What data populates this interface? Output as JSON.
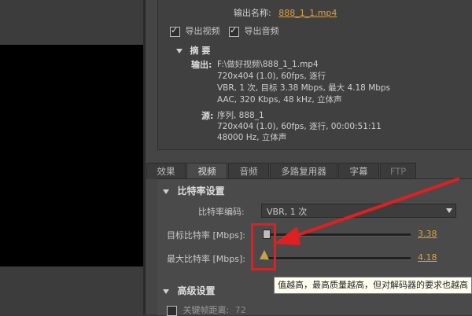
{
  "export": {
    "output_name_label": "输出名称:",
    "output_name_value": "888_1_1.mp4",
    "export_video_label": "导出视频",
    "export_audio_label": "导出音频",
    "export_video_checked": true,
    "export_audio_checked": true
  },
  "summary": {
    "title": "摘 要",
    "output_label": "输出:",
    "output_lines": [
      "F:\\做好视频\\888_1_1.mp4",
      "720x404 (1.0), 60fps, 逐行",
      "VBR, 1 次, 目标 3.38 Mbps, 最大 4.18 Mbps",
      "AAC, 320 Kbps, 48  kHz, 立体声"
    ],
    "source_label": "源:",
    "source_lines": [
      "序列, 888_1",
      "720x404 (1.0), 60fps, 逐行, 00:00:51:11",
      "48000 Hz, 立体声"
    ]
  },
  "tabs": [
    {
      "label": "效果",
      "active": false
    },
    {
      "label": "视频",
      "active": true
    },
    {
      "label": "音频",
      "active": false
    },
    {
      "label": "多路复用器",
      "active": false
    },
    {
      "label": "字幕",
      "active": false
    },
    {
      "label": "FTP",
      "active": false,
      "disabled": true
    }
  ],
  "bitrate": {
    "section_title": "比特率设置",
    "encoding_label": "比特率编码:",
    "encoding_value": "VBR, 1 次",
    "target_label": "目标比特率 [Mbps]:",
    "target_value": "3.38",
    "max_label": "最大比特率 [Mbps]:",
    "max_value": "4.18"
  },
  "advanced": {
    "section_title": "高级设置",
    "keyframe_label": "关键帧距离:",
    "keyframe_value": "72"
  },
  "tooltip": {
    "text": "值越高，最高质量越高，但对解码器的要求也越高"
  },
  "colors": {
    "link": "#e0a040",
    "annotation": "#e02020"
  }
}
